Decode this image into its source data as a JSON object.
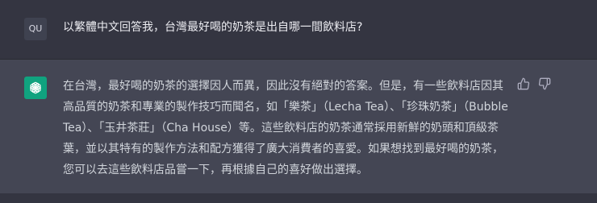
{
  "user": {
    "avatar_label": "QU",
    "message": "以繁體中文回答我，台灣最好喝的奶茶是出自哪一間飲料店?"
  },
  "assistant": {
    "avatar_icon": "openai-logo-icon",
    "message": "在台灣，最好喝的奶茶的選擇因人而異，因此沒有絕對的答案。但是，有一些飲料店因其高品質的奶茶和專業的製作技巧而聞名，如「樂茶」（Lecha Tea）、「珍珠奶茶」（Bubble Tea）、「玉井茶莊」（Cha House）等。這些飲料店的奶茶通常採用新鮮的奶頭和頂級茶葉，並以其特有的製作方法和配方獲得了廣大消費者的喜愛。如果想找到最好喝的奶茶，您可以去這些飲料店品嘗一下，再根據自己的喜好做出選擇。",
    "feedback": {
      "thumbs_up_icon": "thumbs-up-icon",
      "thumbs_down_icon": "thumbs-down-icon"
    }
  },
  "colors": {
    "background": "#343541",
    "assistant_background": "#444654",
    "brand_green": "#10a37f",
    "text": "#d1d5db"
  }
}
